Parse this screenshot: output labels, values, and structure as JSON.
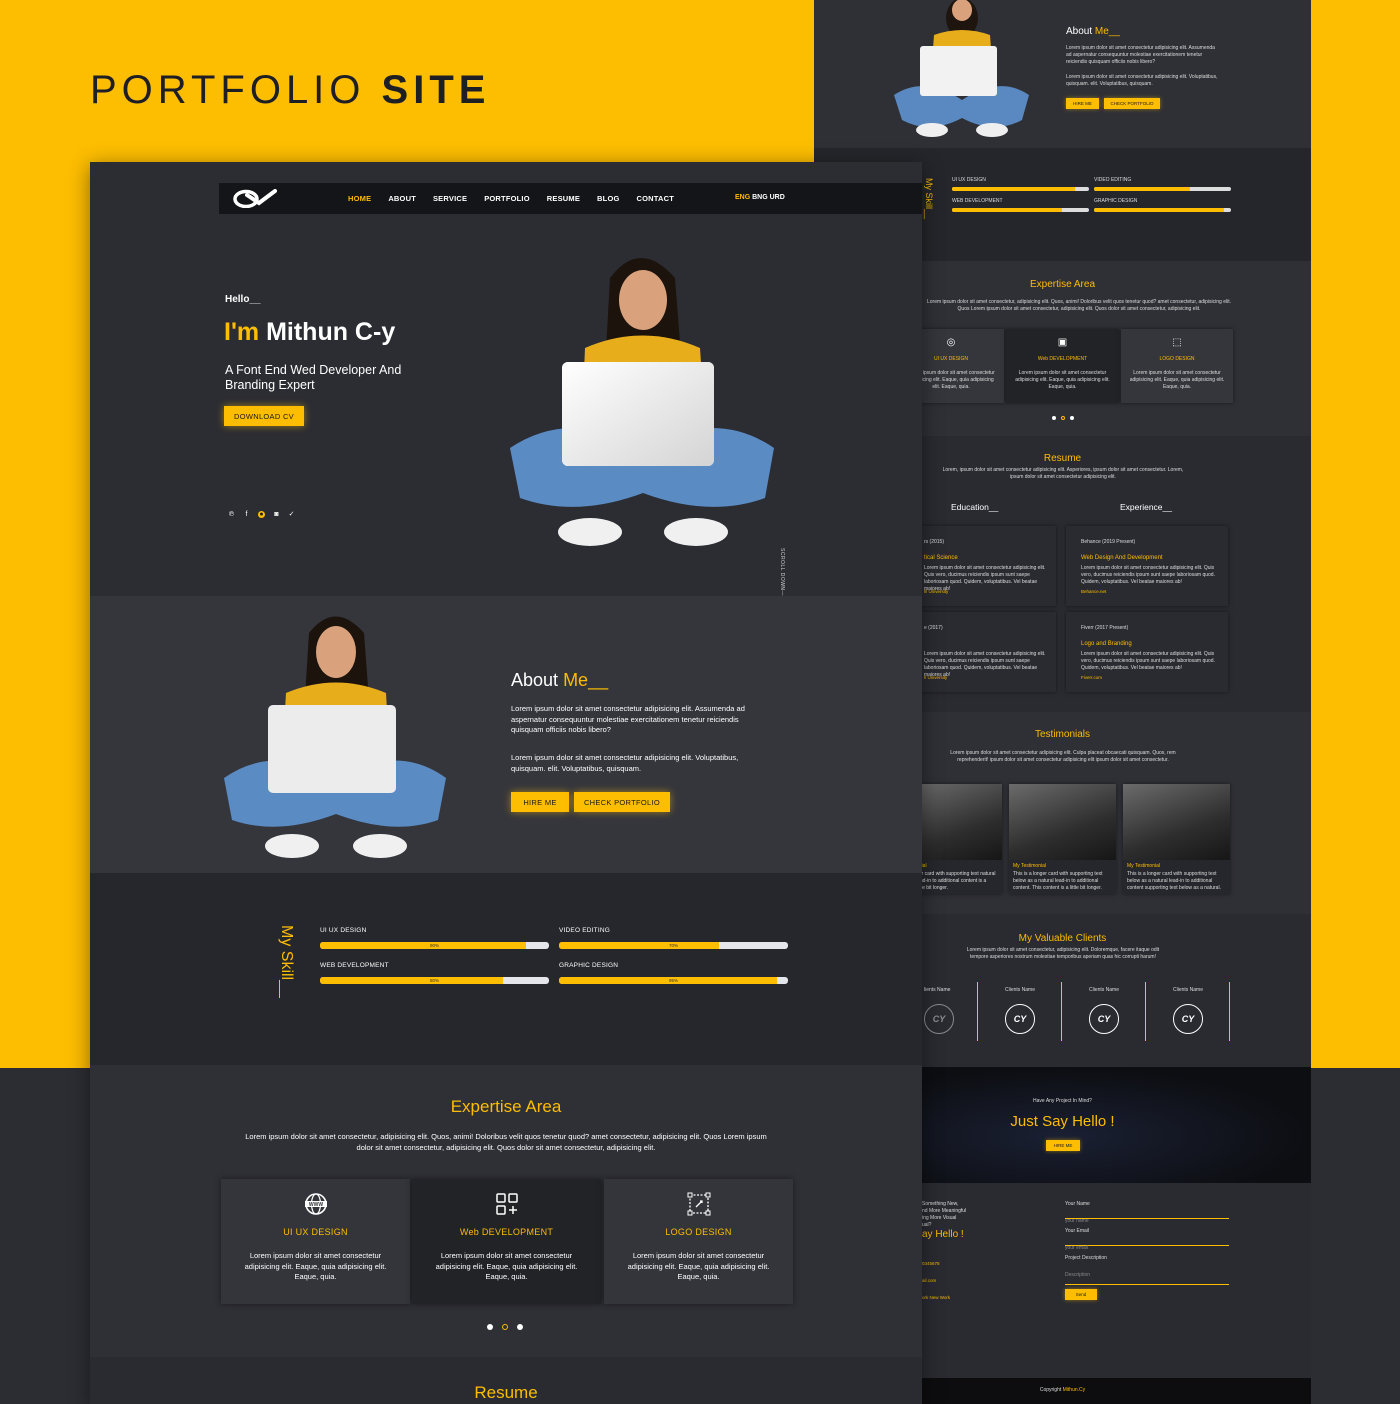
{
  "pitch": {
    "word1": "PORTFOLIO",
    "word2": "SITE"
  },
  "colors": {
    "accent": "#fdbd00",
    "dark": "#2c2d33",
    "navbar": "#141518"
  },
  "nav": {
    "logo_text": "CY",
    "items": [
      "HOME",
      "ABOUT",
      "SERVICE",
      "PORTFOLIO",
      "RESUME",
      "BLOG",
      "CONTACT"
    ],
    "active": "HOME",
    "lang_active": "ENG",
    "lang_others": "BNG URD"
  },
  "hero": {
    "hello": "Hello__",
    "im": "I'm",
    "name": "Mithun C-y",
    "tagline": "A Font End Wed Developer And Branding Expert",
    "download_btn": "DOWNLOAD CV",
    "socials": [
      "pinterest-icon",
      "facebook-icon",
      "dribbble-icon",
      "instagram-icon",
      "twitter-icon"
    ],
    "scroll_text": "SCROLL DOWN—"
  },
  "about": {
    "title": "About",
    "title_accent": "Me__",
    "para1": "Lorem ipsum dolor sit amet consectetur adipisicing elit. Assumenda ad aspernatur consequuntur molestiae exercitationem tenetur reiciendis quisquam officiis nobis libero?",
    "para2": "Lorem ipsum dolor sit amet consectetur adipisicing elit. Voluptatibus, quisquam. elit. Voluptatibus, quisquam.",
    "hire_btn": "HIRE ME",
    "portfolio_btn": "CHECK PORTFOLIO"
  },
  "skills": {
    "title": "My Skill__",
    "items": [
      {
        "label": "UI UX DESIGN",
        "value": 90,
        "text": "90%"
      },
      {
        "label": "VIDEO EDITING",
        "value": 70,
        "text": "70%"
      },
      {
        "label": "WEB DEVELOPMENT",
        "value": 80,
        "text": "80%"
      },
      {
        "label": "GRAPHIC DESIGN",
        "value": 95,
        "text": "95%"
      }
    ]
  },
  "expertise": {
    "title": "Expertise Area",
    "desc": "Lorem ipsum dolor sit amet consectetur, adipisicing elit. Quos, animi! Doloribus velit quos tenetur quod? amet consectetur, adipisicing elit. Quos Lorem ipsum dolor sit amet consectetur, adipisicing elit. Quos dolor sit amet consectetur, adipisicing elit.",
    "cards": [
      {
        "icon": "globe-www-icon",
        "title": "UI UX DESIGN",
        "text": "Lorem ipsum dolor sit amet consectetur adipisicing elit. Eaque, quia adipisicing elit. Eaque, quia."
      },
      {
        "icon": "grid-plus-icon",
        "title": "Web DEVELOPMENT",
        "text": "Lorem ipsum dolor sit amet consectetur adipisicing elit. Eaque, quia adipisicing elit. Eaque, quia."
      },
      {
        "icon": "vector-pen-icon",
        "title": "LOGO DESIGN",
        "text": "Lorem ipsum dolor sit amet consectetur adipisicing elit. Eaque, quia adipisicing elit. Eaque, quia."
      }
    ]
  },
  "resume": {
    "title": "Resume",
    "desc": "Lorem, ipsum dolor sit amet consectetur adipisicing elit. Asperiores, ipsum dolor sit amet consectetur. Lorem, ipsum dolor sit amet consectetur adipisicing elit.",
    "education": "Education__",
    "experience": "Experience__",
    "edu_items": [
      {
        "date": "rs (2015)",
        "title": "tical Science",
        "place": "Ill University"
      },
      {
        "date": "e (2017)",
        "title": "",
        "place": "Il University"
      }
    ],
    "exp_items": [
      {
        "date": "Behance (2019 Present)",
        "title": "Web Design And Development",
        "place": "Behance.net"
      },
      {
        "date": "Fiverr (2017 Present)",
        "title": "Logo and Branding",
        "place": "Fiverr.com"
      }
    ],
    "item_text": "Lorem ipsum dolor sit amet consectetur adipisicing elit. Quis vero, ducimus reiciendis ipsum sunt saepe laboriosam quod. Quidem, voluptatibus. Vel beatae maiores ab!"
  },
  "testimonials": {
    "title": "Testimonials",
    "desc": "Lorem ipsum dolor sit amet consectetur adipisicing elit. Culpa placeat obcaecati quisquam. Quos, rem reprehenderit! ipsum dolor sit amet consectetur adipisicing elit ipsum dolor sit amet consectetur.",
    "items": [
      {
        "title": "onial",
        "text": "ger card with supporting text natural lead-in to additional content is a little bit longer."
      },
      {
        "title": "My Testimonial",
        "text": "This is a longer card with supporting text below as a natural lead-in to additional content. This content is a little bit longer."
      },
      {
        "title": "My Testimonial",
        "text": "This is a longer card with supporting text below as a natural lead-in to additional content supporting text below as a natural."
      }
    ]
  },
  "clients": {
    "title": "My Valuable Clients",
    "desc": "Lorem ipsum dolor sit amet consectetur, adipisicing elit. Doloremque, facere itaque odit tempore asperiores nostrum molestiae temporibus aperiam quas hic corrupti harum!",
    "label": "Clients Name",
    "label_cut": "lients Name"
  },
  "cta": {
    "small": "Have Any Project In Mind?",
    "big": "Just Say Hello !",
    "btn": "HIRE ME"
  },
  "contact": {
    "side_lines": [
      "Something New,",
      "nd More Meaningful",
      "ing More Visual",
      "ual?"
    ],
    "side_title": "ay Hello !",
    "side_phone": "0345678",
    "side_mail": "ail.com",
    "side_addr": "ork New Work",
    "name_label": "Your Name",
    "name_ph": "your name",
    "email_label": "Your Email",
    "email_ph": "your email",
    "desc_label": "Project Description",
    "desc_ph": "Description",
    "send_btn": "Send"
  },
  "footer": {
    "text": "Copyright",
    "accent": "Mithun.Cy"
  }
}
